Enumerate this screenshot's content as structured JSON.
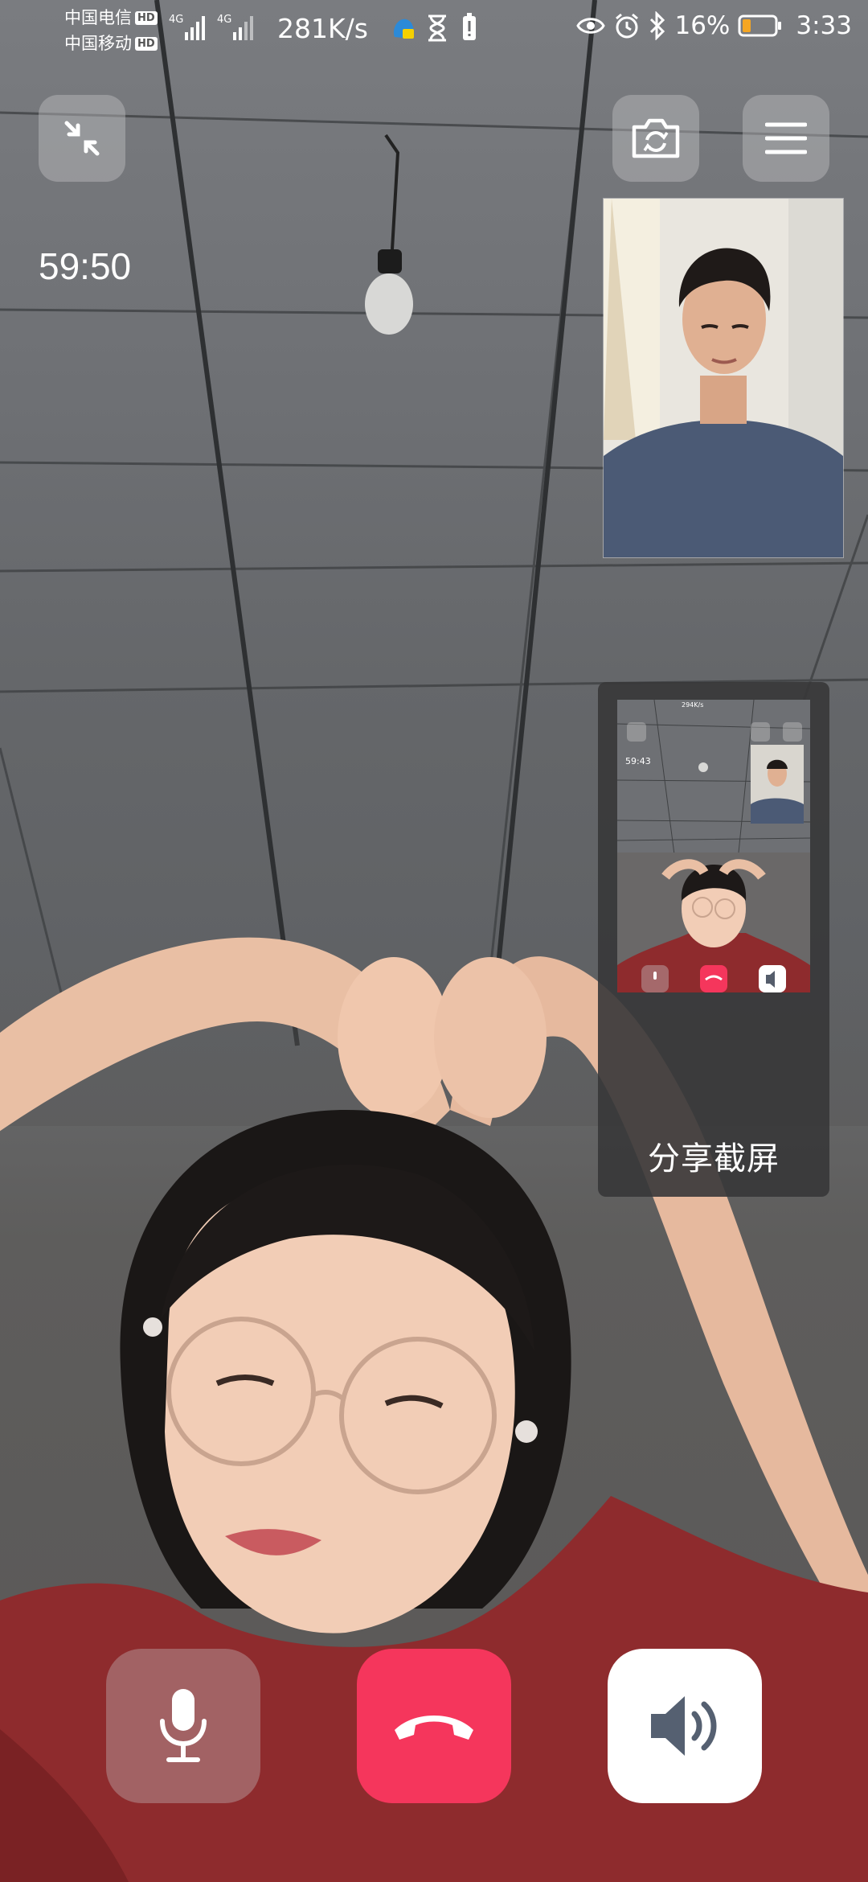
{
  "status_bar": {
    "carrier_1": "中国电信",
    "carrier_2": "中国移动",
    "hd_badge": "HD",
    "network_type": "4G",
    "net_speed": "281K/s",
    "battery_percent": "16%",
    "time": "3:33"
  },
  "call": {
    "duration": "59:50"
  },
  "share_popup": {
    "label": "分享截屏",
    "thumb_net_speed": "294K/s",
    "thumb_duration": "59:43"
  },
  "icons": {
    "minimize": "minimize-icon",
    "switch_camera": "switch-camera-icon",
    "menu": "menu-icon",
    "mic": "microphone-icon",
    "hang_up": "hang-up-icon",
    "speaker": "speaker-icon"
  },
  "colors": {
    "hang_up": "#f5365c",
    "speaker_bg": "#ffffff",
    "battery_low": "#f5a623"
  }
}
